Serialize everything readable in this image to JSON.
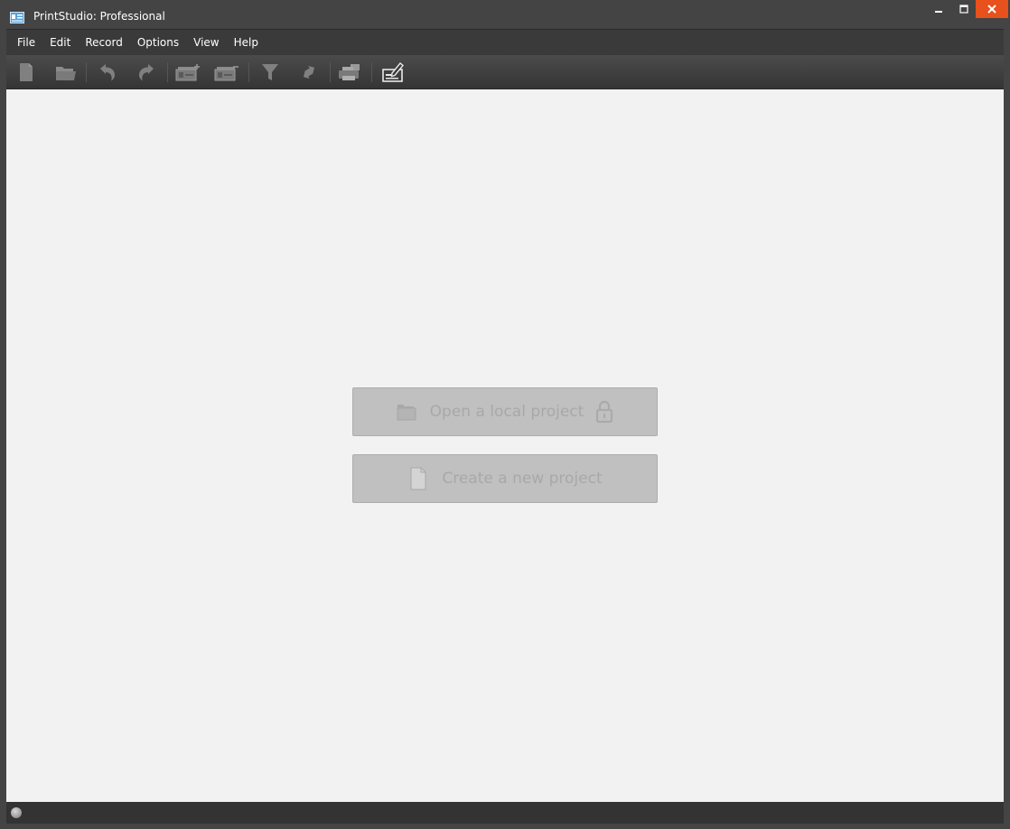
{
  "window": {
    "title": "PrintStudio: Professional"
  },
  "menu": {
    "items": [
      "File",
      "Edit",
      "Record",
      "Options",
      "View",
      "Help"
    ]
  },
  "toolbar": {
    "icons": [
      "new-document-icon",
      "open-folder-icon",
      "undo-icon",
      "redo-icon",
      "add-record-icon",
      "remove-record-icon",
      "filter-icon",
      "sync-icon",
      "print-icon",
      "edit-card-icon"
    ]
  },
  "main": {
    "open_project_label": "Open a local project",
    "create_project_label": "Create a new project"
  },
  "colors": {
    "close_button": "#e8501c",
    "content_background": "#f2f2f2",
    "button_background": "#c0c0c0",
    "chrome": "#444444"
  }
}
